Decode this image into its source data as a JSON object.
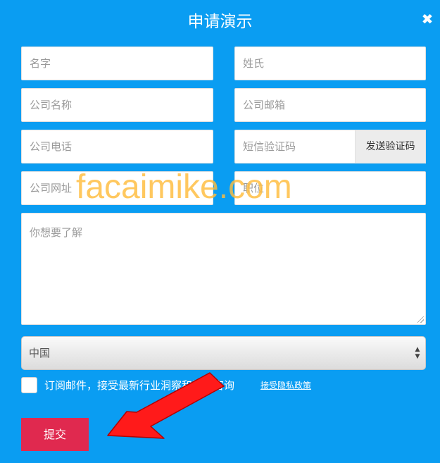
{
  "modal": {
    "title": "申请演示",
    "close_glyph": "✖"
  },
  "form": {
    "first_name_placeholder": "名字",
    "last_name_placeholder": "姓氏",
    "company_name_placeholder": "公司名称",
    "company_email_placeholder": "公司邮箱",
    "company_phone_placeholder": "公司电话",
    "sms_code_placeholder": "短信验证码",
    "send_code_label": "发送验证码",
    "company_website_placeholder": "公司网址",
    "job_title_placeholder": "职位",
    "message_placeholder": "你想要了解",
    "country_selected": "中国",
    "select_arrows": "▲▼",
    "subscribe_label": "订阅邮件，接受最新行业洞察和活动咨询",
    "privacy_link": "接受隐私政策",
    "submit_label": "提交"
  },
  "watermark": {
    "text": "facaimike.com"
  },
  "colors": {
    "background": "#0a9df2",
    "submit": "#e0294f",
    "arrow": "#ff1a1a",
    "watermark": "#ffbc3c"
  }
}
